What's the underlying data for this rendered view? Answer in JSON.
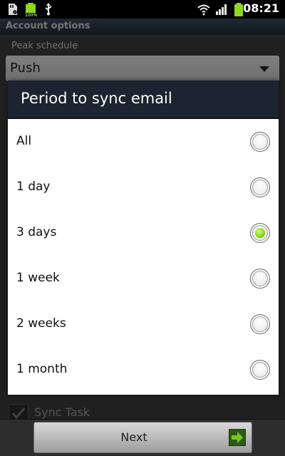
{
  "status_bar": {
    "time": "08:21",
    "icons": [
      "sd-card-icon",
      "battery-full-icon",
      "usb-icon",
      "wifi-icon",
      "signal-icon",
      "battery-icon"
    ],
    "battery_small_label": "100%"
  },
  "header": {
    "title": "Account options"
  },
  "background": {
    "peak_label": "Peak schedule",
    "peak_value": "Push",
    "bottom_item_label": "Sync Task"
  },
  "dialog": {
    "title": "Period to sync email",
    "options": [
      {
        "label": "All",
        "selected": false
      },
      {
        "label": "1 day",
        "selected": false
      },
      {
        "label": "3 days",
        "selected": true
      },
      {
        "label": "1 week",
        "selected": false
      },
      {
        "label": "2 weeks",
        "selected": false
      },
      {
        "label": "1 month",
        "selected": false
      }
    ]
  },
  "footer": {
    "next_label": "Next"
  },
  "colors": {
    "dialog_title_bg": "#1b2430",
    "radio_selected": "#8ed81f",
    "next_arrow": "#7dc21e"
  }
}
